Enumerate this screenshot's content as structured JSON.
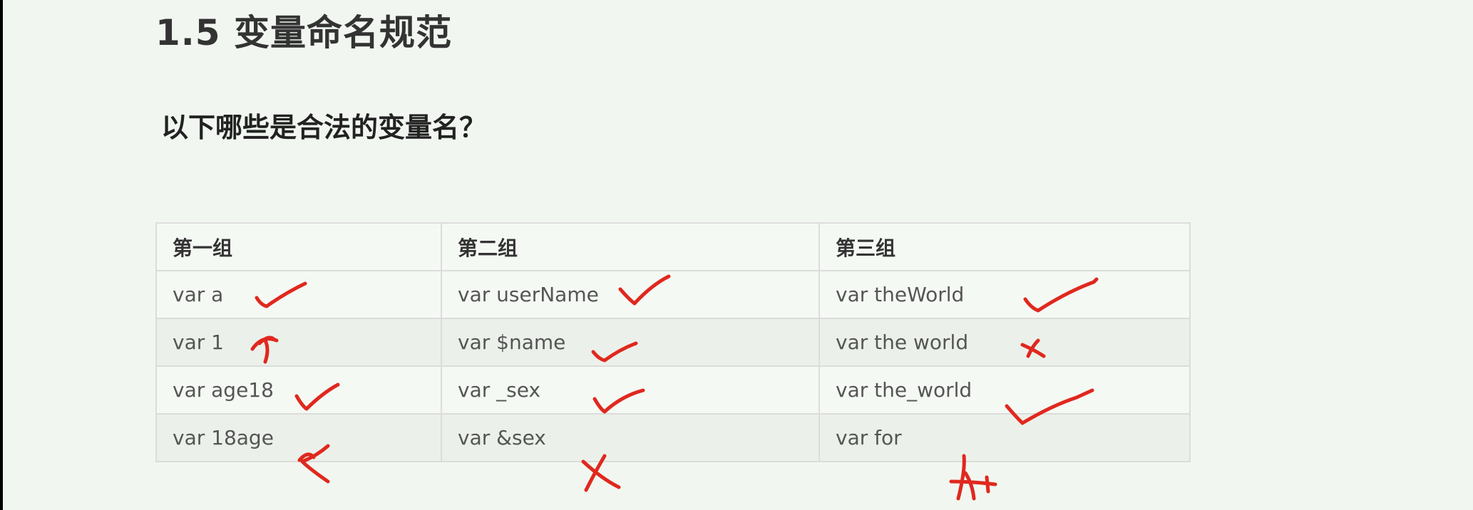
{
  "slide": {
    "title": "1.5 变量命名规范",
    "question": "以下哪些是合法的变量名？"
  },
  "table": {
    "headers": [
      "第一组",
      "第二组",
      "第三组"
    ],
    "rows": [
      [
        "var a",
        "var userName",
        "var theWorld"
      ],
      [
        "var 1",
        "var $name",
        "var the world"
      ],
      [
        "var age18",
        "var _sex",
        "var the_world"
      ],
      [
        "var 18age",
        "var &sex",
        "var for"
      ]
    ]
  },
  "annotations": {
    "ink_color": "#e0281e",
    "marks": [
      [
        "check",
        "check",
        "check"
      ],
      [
        "cross",
        "check",
        "cross"
      ],
      [
        "check",
        "check",
        "check"
      ],
      [
        "cross",
        "cross",
        "cross"
      ]
    ]
  }
}
